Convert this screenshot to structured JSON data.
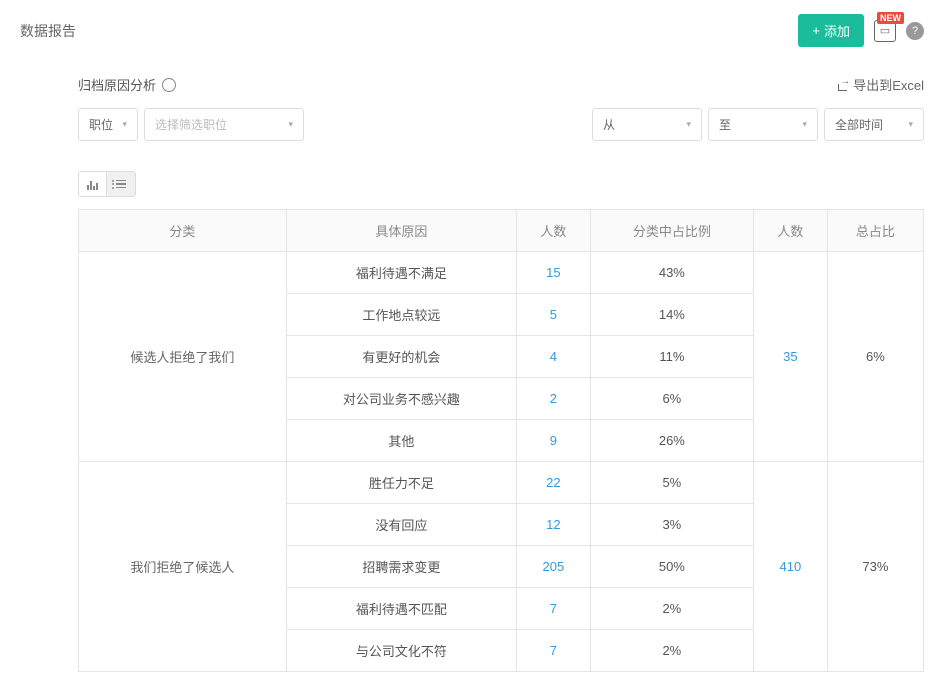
{
  "header": {
    "title": "数据报告",
    "add_label": "添加",
    "new_badge": "NEW"
  },
  "subheader": {
    "title": "归档原因分析",
    "export_label": "导出到Excel"
  },
  "filters": {
    "position_label": "职位",
    "position_placeholder": "选择筛选职位",
    "from_label": "从",
    "to_label": "至",
    "time_label": "全部时间"
  },
  "table": {
    "headers": {
      "category": "分类",
      "reason": "具体原因",
      "count1": "人数",
      "pct_in_cat": "分类中占比例",
      "count2": "人数",
      "total_pct": "总占比"
    },
    "groups": [
      {
        "category": "候选人拒绝了我们",
        "total_count": "35",
        "total_pct": "6%",
        "rows": [
          {
            "reason": "福利待遇不满足",
            "count": "15",
            "pct": "43%"
          },
          {
            "reason": "工作地点较远",
            "count": "5",
            "pct": "14%"
          },
          {
            "reason": "有更好的机会",
            "count": "4",
            "pct": "11%"
          },
          {
            "reason": "对公司业务不感兴趣",
            "count": "2",
            "pct": "6%"
          },
          {
            "reason": "其他",
            "count": "9",
            "pct": "26%"
          }
        ]
      },
      {
        "category": "我们拒绝了候选人",
        "total_count": "410",
        "total_pct": "73%",
        "rows": [
          {
            "reason": "胜任力不足",
            "count": "22",
            "pct": "5%"
          },
          {
            "reason": "没有回应",
            "count": "12",
            "pct": "3%"
          },
          {
            "reason": "招聘需求变更",
            "count": "205",
            "pct": "50%"
          },
          {
            "reason": "福利待遇不匹配",
            "count": "7",
            "pct": "2%"
          },
          {
            "reason": "与公司文化不符",
            "count": "7",
            "pct": "2%"
          }
        ]
      }
    ]
  }
}
